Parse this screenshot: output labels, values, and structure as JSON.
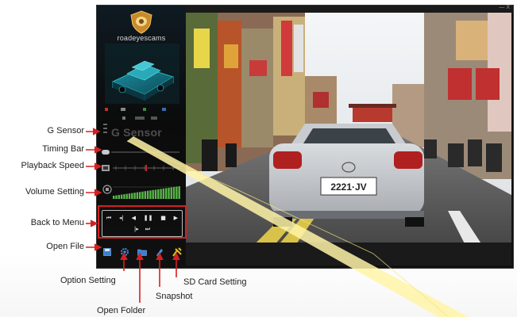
{
  "brand": {
    "name": "roadeyescams"
  },
  "panel": {
    "gsensor_title": "G Sensor"
  },
  "window": {
    "controls": "— X"
  },
  "plate": {
    "text": "2221·JV"
  },
  "callouts": {
    "g_sensor": "G Sensor",
    "timing_bar": "Timing Bar",
    "playback_speed": "Playback Speed",
    "volume_setting": "Volume Setting",
    "back_to_menu": "Back to Menu",
    "open_file": "Open File",
    "option_setting": "Option Setting",
    "open_folder": "Open Folder",
    "snapshot": "Snapshot",
    "sd_card_setting": "SD Card Setting"
  },
  "colors": {
    "callout_red": "#d62020",
    "volume_green": "#58b848",
    "beam_yellow": "#fff4a8"
  },
  "icons": [
    "first-frame-icon",
    "step-back-icon",
    "play-reverse-icon",
    "pause-icon",
    "stop-icon",
    "play-icon",
    "step-forward-icon",
    "last-frame-icon",
    "save-icon",
    "gear-icon",
    "folder-icon",
    "camera-icon",
    "sd-card-icon"
  ]
}
